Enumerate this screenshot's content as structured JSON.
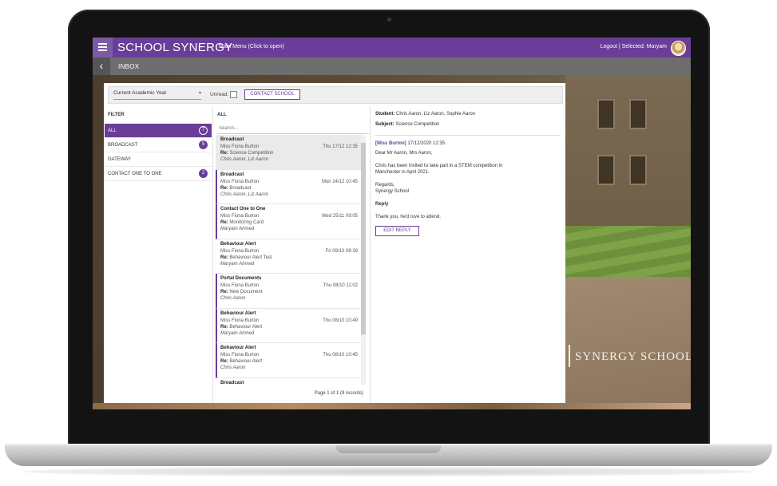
{
  "app": {
    "brand": "SCHOOL SYNERGY",
    "main_menu": "Main Menu (Click to open)",
    "logout": "Logout | Selected: Maryam"
  },
  "subbar": {
    "title": "INBOX"
  },
  "toolbar": {
    "year": "Current Academic Year",
    "unread_label": "Unread:",
    "contact_button": "CONTACT SCHOOL"
  },
  "filter": {
    "heading": "FILTER",
    "items": [
      {
        "label": "ALL",
        "count": "7",
        "active": true
      },
      {
        "label": "BROADCAST",
        "count": "5"
      },
      {
        "label": "GATEWAY",
        "count": ""
      },
      {
        "label": "CONTACT ONE TO ONE",
        "count": "2"
      }
    ]
  },
  "list": {
    "heading": "ALL",
    "search_placeholder": "Search...",
    "re_prefix": "Re:",
    "pager": "Page 1 of 1 (9 records)",
    "messages": [
      {
        "type": "Broadcast",
        "from": "Miss Fiona Burton",
        "date": "Thu 17/12 12:35",
        "subject": "Science Competition",
        "students": "Chris Aaron, Liz Aaron"
      },
      {
        "type": "Broadcast",
        "from": "Miss Fiona Burton",
        "date": "Mon 14/12 10:45",
        "subject": "Broadcast",
        "students": "Chris Aaron, Liz Aaron"
      },
      {
        "type": "Contact One to One",
        "from": "Miss Fiona Burton",
        "date": "Wed 25/11 09:05",
        "subject": "Monitoring Card",
        "students": "Maryam Ahmed"
      },
      {
        "type": "Behaviour Alert",
        "from": "Miss Fiona Burton",
        "date": "Fri 09/10 08:39",
        "subject": "Behaviour Alert Test",
        "students": "Maryam Ahmed"
      },
      {
        "type": "Portal Documents",
        "from": "Miss Fiona Burton",
        "date": "Thu 08/10 11:02",
        "subject": "New Document",
        "students": "Chris Aaron"
      },
      {
        "type": "Behaviour Alert",
        "from": "Miss Fiona Burton",
        "date": "Thu 08/10 10:49",
        "subject": "Behaviour Alert",
        "students": "Maryam Ahmed"
      },
      {
        "type": "Behaviour Alert",
        "from": "Miss Fiona Burton",
        "date": "Thu 08/10 10:45",
        "subject": "Behaviour Alert",
        "students": "Chris Aaron"
      },
      {
        "type": "Broadcast",
        "from": "",
        "date": "",
        "subject": "",
        "students": ""
      }
    ]
  },
  "detail": {
    "student_label": "Student:",
    "student_value": "Chris Aaron, Liz Aaron, Sophie Aaron",
    "subject_label": "Subject:",
    "subject_value": "Science Competition",
    "sender": "[Miss Burton]",
    "timestamp": "17/12/2020 12:35",
    "greeting": "Dear Mr Aaron, Mrs Aaron,",
    "body_line1": "Chris has been invited to take part in a STEM competition in",
    "body_line2": "Manchester in April 2021.",
    "regards": "Regards,",
    "signature": "Synergy School",
    "reply_heading": "Reply",
    "reply_text": "Thank you, he'd love to attend.",
    "edit_button": "EDIT REPLY"
  },
  "backdrop": {
    "school_name": "SYNERGY SCHOOL"
  },
  "colors": {
    "accent": "#6a3d98",
    "subbar": "#6d6d6d"
  }
}
